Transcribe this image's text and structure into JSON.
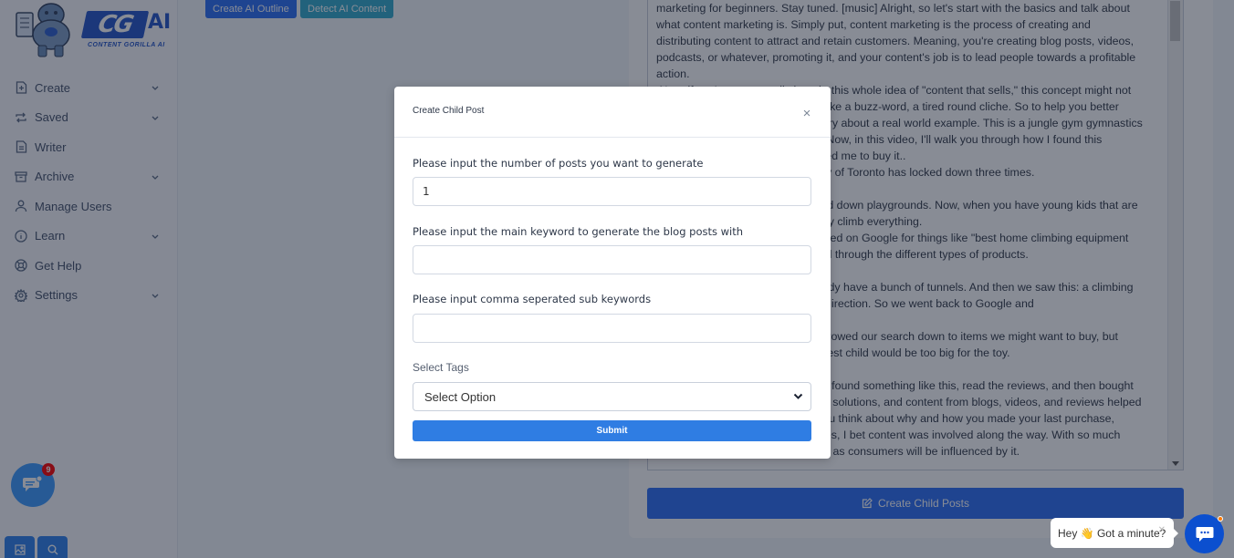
{
  "brand": {
    "logo_text": "CG",
    "logo_ai": "AI",
    "logo_tagline": "CONTENT GORILLA AI"
  },
  "sidebar": {
    "items": [
      {
        "label": "Create",
        "icon": "file-plus-icon",
        "has_chevron": true
      },
      {
        "label": "Saved",
        "icon": "repeat-icon",
        "has_chevron": true
      },
      {
        "label": "Writer",
        "icon": "file-text-icon",
        "has_chevron": false
      },
      {
        "label": "Archive",
        "icon": "archive-icon",
        "has_chevron": true
      },
      {
        "label": "Manage Users",
        "icon": "user-icon",
        "has_chevron": false
      },
      {
        "label": "Learn",
        "icon": "info-icon",
        "has_chevron": true
      },
      {
        "label": "Get Help",
        "icon": "lifebuoy-icon",
        "has_chevron": false
      },
      {
        "label": "Settings",
        "icon": "gear-icon",
        "has_chevron": true
      }
    ],
    "chat_badge_count": "9"
  },
  "toolbar": {
    "create_outline_label": "Create AI Outline",
    "detect_content_label": "Detect AI Content"
  },
  "editor": {
    "text": "marketing for beginners. Stay tuned. [music] Alright, so let's start with the basics and talk about what content marketing is. Simply put, content marketing is the process of creating and distributing content to attract and retain customers. Meaning, you're creating blog posts, videos, podcasts, or whatever, promoting it, and your content's job is to lead people towards a profitable action.\n Now, if you've never really bought this whole idea of \"content that sells,\" this concept might not make much sense and just seem like a buzz-word, a tired round cliche. So to help you better understand, I want to tell you a story about a real world example. This is a jungle gym gymnastics bar for kids that I bought recently. Now, in this video, I'll walk you through how I found this product, and how content influenced me to buy it..\n During the past year or so, the city of Toronto has locked down three times.\n\n And during lockdowns, they closed down playgrounds. Now, when you have young kids that are forced to stay at home, they literally climb everything.\n So we went searching. We searched on Google for things like \"best home climbing equipment for kids,\" read articles, and scrolled through the different types of products.\n\n We looked at slides, and we already have a bunch of tunnels. And then we saw this: a climbing bar. We were heading in the right direction. So we went back to Google and\n\n read more reviews and posts, narrowed our search down to items we might want to buy, but then we started to see that our oldest child would be too big for the toy.\n\n So we searched for more options, found something like this, read the reviews, and then bought it. We had a problem, searched for solutions, and content from blogs, videos, and reviews helped us on our buying journey. And if you think about why and how you made your last purchase, whether it's the groceries, or clothes, I bet content was involved along the way. With so much content at the tip of our fingers, we as consumers will be influenced by it.\n\n The content we researched was from multiple sites and creators. And the Amazon seller who got our hundred bucks just happened to luck out.",
    "create_child_posts_label": "Create Child Posts"
  },
  "modal": {
    "title": "Create Child Post",
    "fields": [
      {
        "label": "Please input the number of posts you want to generate",
        "value": "1",
        "placeholder": ""
      },
      {
        "label": "Please input the main keyword to generate the blog posts with",
        "value": "",
        "placeholder": ""
      },
      {
        "label": "Please input comma seperated sub keywords",
        "value": "",
        "placeholder": ""
      }
    ],
    "tags_label": "Select Tags",
    "tags_selected": "Select Option",
    "submit_label": "Submit"
  },
  "chat_widget": {
    "greeting": "Hey 👋 Got a minute?"
  },
  "colors": {
    "primary": "#2f7de3",
    "brand_blue": "#2455c8",
    "detect_teal": "#33aacc",
    "badge_red": "#ff0000",
    "messenger_blue": "#0b4fcf"
  }
}
